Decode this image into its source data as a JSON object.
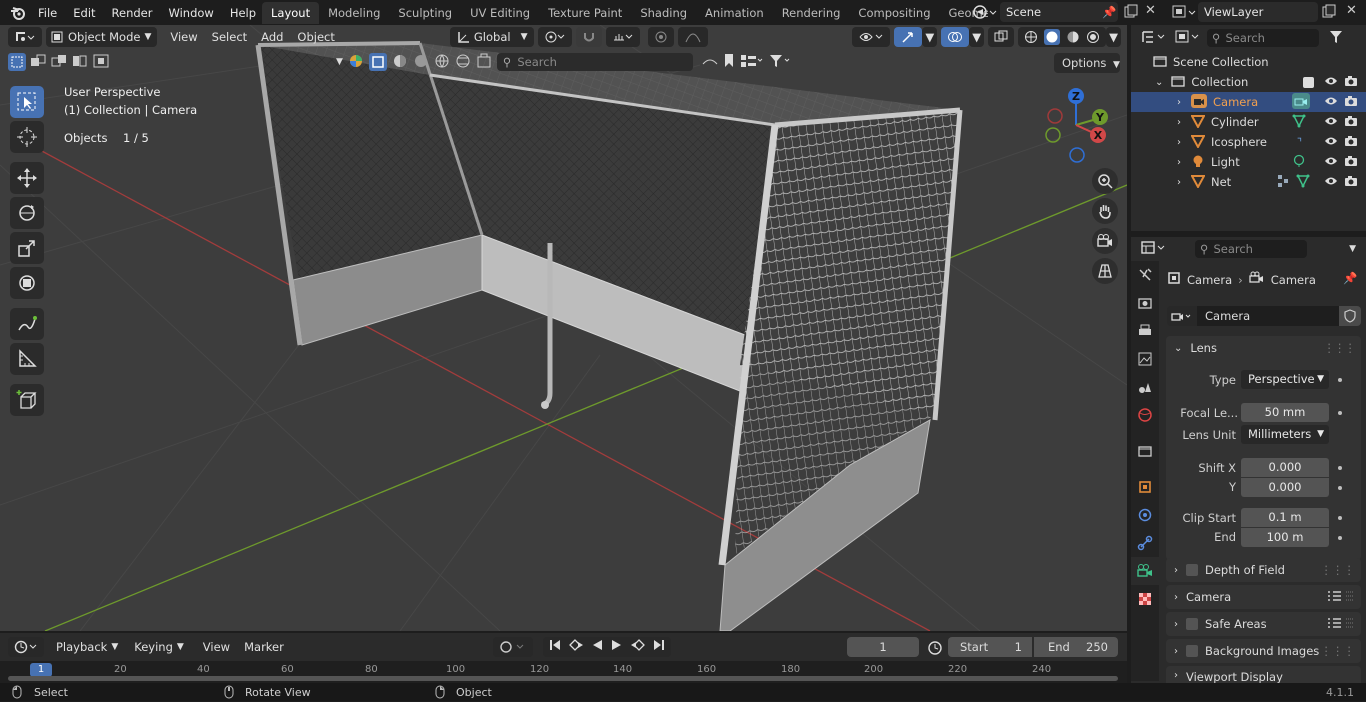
{
  "topbar": {
    "menus": [
      "File",
      "Edit",
      "Render",
      "Window",
      "Help"
    ],
    "workspace_tabs": [
      {
        "label": "Layout",
        "active": true
      },
      {
        "label": "Modeling",
        "active": false
      },
      {
        "label": "Sculpting",
        "active": false
      },
      {
        "label": "UV Editing",
        "active": false
      },
      {
        "label": "Texture Paint",
        "active": false
      },
      {
        "label": "Shading",
        "active": false
      },
      {
        "label": "Animation",
        "active": false
      },
      {
        "label": "Rendering",
        "active": false
      },
      {
        "label": "Compositing",
        "active": false
      },
      {
        "label": "Geomet",
        "active": false
      }
    ],
    "scene": "Scene",
    "view_layer": "ViewLayer"
  },
  "viewport_header": {
    "mode": "Object Mode",
    "menus": [
      "View",
      "Select",
      "Add",
      "Object"
    ],
    "transform_orientation": "Global",
    "search_placeholder": "Search",
    "options_label": "Options"
  },
  "viewport_overlay": {
    "view_name": "User Perspective",
    "context": "(1) Collection | Camera",
    "objects_label": "Objects",
    "objects_count": "1 / 5"
  },
  "gizmo": {
    "x": "X",
    "y": "Y",
    "z": "Z"
  },
  "outliner": {
    "search_placeholder": "Search",
    "root": "Scene Collection",
    "collection": "Collection",
    "items": [
      {
        "name": "Camera",
        "selected": true
      },
      {
        "name": "Cylinder",
        "selected": false
      },
      {
        "name": "Icosphere",
        "selected": false
      },
      {
        "name": "Light",
        "selected": false
      },
      {
        "name": "Net",
        "selected": false
      }
    ]
  },
  "properties": {
    "search_placeholder": "Search",
    "breadcrumb": [
      "Camera",
      "Camera"
    ],
    "datablock": "Camera",
    "lens_panel": "Lens",
    "type_label": "Type",
    "type_value": "Perspective",
    "focal_label": "Focal Le...",
    "focal_value": "50 mm",
    "lens_unit_label": "Lens Unit",
    "lens_unit_value": "Millimeters",
    "shift_x_label": "Shift X",
    "shift_x_value": "0.000",
    "shift_y_label": "Y",
    "shift_y_value": "0.000",
    "clip_start_label": "Clip Start",
    "clip_start_value": "0.1 m",
    "clip_end_label": "End",
    "clip_end_value": "100 m",
    "collapsed_panels": [
      "Depth of Field",
      "Camera",
      "Safe Areas",
      "Background Images",
      "Viewport Display"
    ]
  },
  "timeline": {
    "menus": [
      "Playback",
      "Keying",
      "View",
      "Marker"
    ],
    "current_frame": "1",
    "start_label": "Start",
    "start_value": "1",
    "end_label": "End",
    "end_value": "250",
    "ruler": [
      "1",
      "20",
      "40",
      "60",
      "80",
      "100",
      "120",
      "140",
      "160",
      "180",
      "200",
      "220",
      "240"
    ]
  },
  "statusbar": {
    "select": "Select",
    "rotate": "Rotate View",
    "object": "Object",
    "version": "4.1.1"
  },
  "colors": {
    "accent": "#4772b3",
    "x_axis": "#b33a3a",
    "y_axis": "#6a9a2a",
    "z_axis": "#2f6fd6",
    "viewport_bg": "#3d3d3d",
    "panel_bg": "#2b2b2b"
  }
}
